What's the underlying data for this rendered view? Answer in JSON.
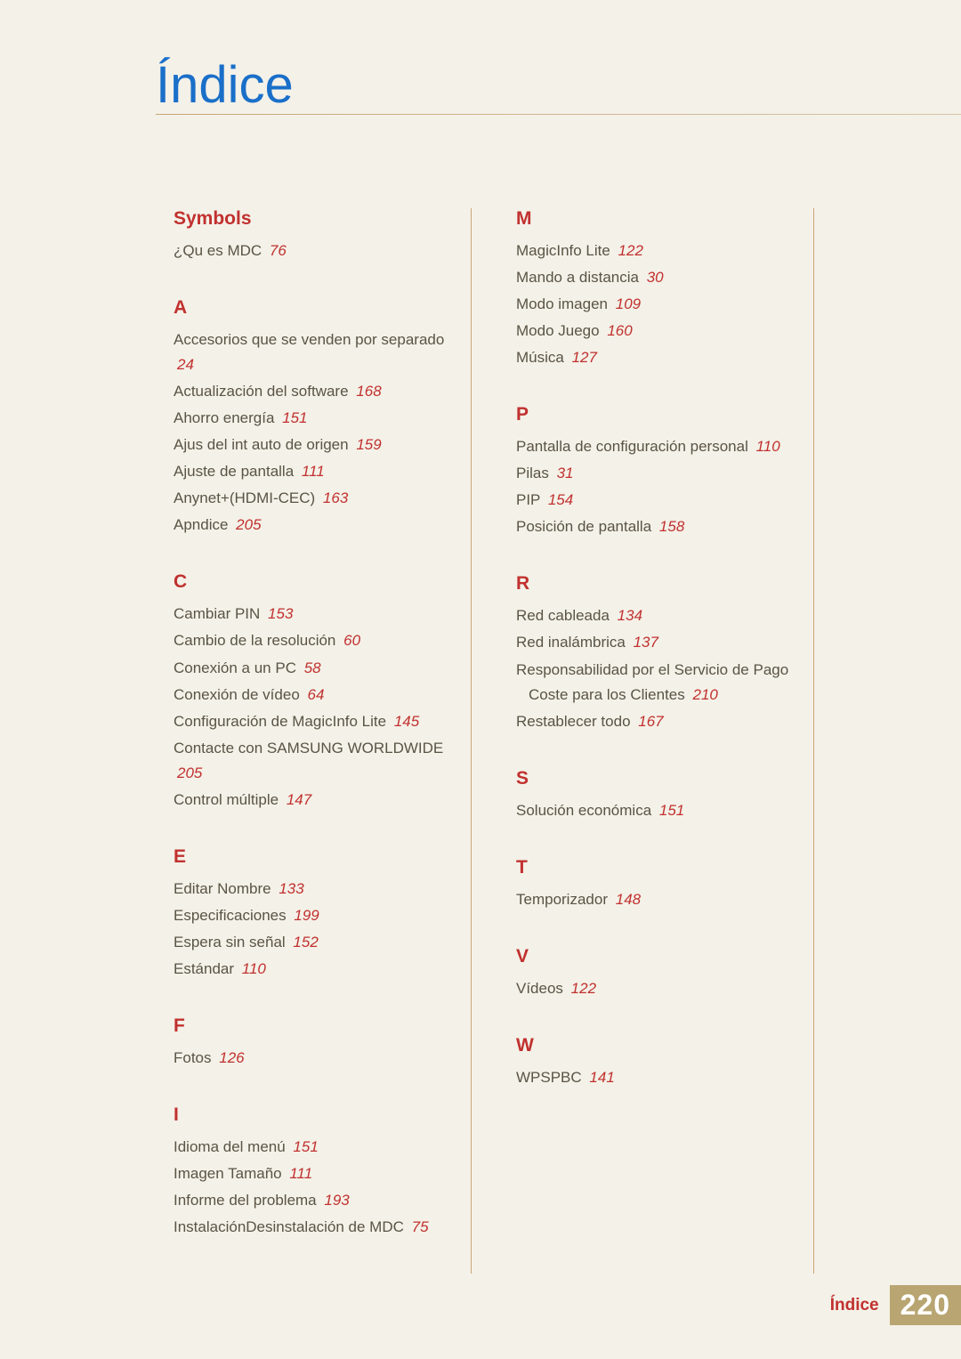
{
  "title": "Índice",
  "footer": {
    "label": "Índice",
    "page": "220"
  },
  "columns": [
    [
      {
        "letter": "Symbols",
        "entries": [
          {
            "text": "¿Qu es MDC",
            "page": "76"
          }
        ]
      },
      {
        "letter": "A",
        "entries": [
          {
            "text": "Accesorios que se venden por separado",
            "page": "24"
          },
          {
            "text": "Actualización del software",
            "page": "168"
          },
          {
            "text": "Ahorro energía",
            "page": "151"
          },
          {
            "text": "Ajus del int auto de origen",
            "page": "159"
          },
          {
            "text": "Ajuste de pantalla",
            "page": "111"
          },
          {
            "text": "Anynet+(HDMI-CEC)",
            "page": "163"
          },
          {
            "text": "Apndice",
            "page": "205"
          }
        ]
      },
      {
        "letter": "C",
        "entries": [
          {
            "text": "Cambiar PIN",
            "page": "153"
          },
          {
            "text": "Cambio de la resolución",
            "page": "60"
          },
          {
            "text": "Conexión a un PC",
            "page": "58"
          },
          {
            "text": "Conexión de vídeo",
            "page": "64"
          },
          {
            "text": "Configuración de MagicInfo Lite",
            "page": "145"
          },
          {
            "text": "Contacte con SAMSUNG WORLDWIDE",
            "page": "205"
          },
          {
            "text": "Control múltiple",
            "page": "147"
          }
        ]
      },
      {
        "letter": "E",
        "entries": [
          {
            "text": "Editar Nombre",
            "page": "133"
          },
          {
            "text": "Especificaciones",
            "page": "199"
          },
          {
            "text": "Espera sin señal",
            "page": "152"
          },
          {
            "text": "Estándar",
            "page": "110"
          }
        ]
      },
      {
        "letter": "F",
        "entries": [
          {
            "text": "Fotos",
            "page": "126"
          }
        ]
      },
      {
        "letter": "I",
        "entries": [
          {
            "text": "Idioma del menú",
            "page": "151"
          },
          {
            "text": "Imagen Tamaño",
            "page": "111"
          },
          {
            "text": "Informe del problema",
            "page": "193"
          },
          {
            "text": "InstalaciónDesinstalación de MDC",
            "page": "75"
          }
        ]
      }
    ],
    [
      {
        "letter": "M",
        "entries": [
          {
            "text": "MagicInfo Lite",
            "page": "122"
          },
          {
            "text": "Mando a distancia",
            "page": "30"
          },
          {
            "text": "Modo imagen",
            "page": "109"
          },
          {
            "text": "Modo Juego",
            "page": "160"
          },
          {
            "text": "Música",
            "page": "127"
          }
        ]
      },
      {
        "letter": "P",
        "entries": [
          {
            "text": "Pantalla de configuración personal",
            "page": "110"
          },
          {
            "text": "Pilas",
            "page": "31"
          },
          {
            "text": "PIP",
            "page": "154"
          },
          {
            "text": "Posición de pantalla",
            "page": "158"
          }
        ]
      },
      {
        "letter": "R",
        "entries": [
          {
            "text": "Red cableada",
            "page": "134"
          },
          {
            "text": "Red inalámbrica",
            "page": "137"
          },
          {
            "text": "Responsabilidad por el Servicio de Pago",
            "cont": "Coste para los Clientes",
            "page": "210"
          },
          {
            "text": "Restablecer todo",
            "page": "167"
          }
        ]
      },
      {
        "letter": "S",
        "entries": [
          {
            "text": "Solución económica",
            "page": "151"
          }
        ]
      },
      {
        "letter": "T",
        "entries": [
          {
            "text": "Temporizador",
            "page": "148"
          }
        ]
      },
      {
        "letter": "V",
        "entries": [
          {
            "text": "Vídeos",
            "page": "122"
          }
        ]
      },
      {
        "letter": "W",
        "entries": [
          {
            "text": "WPSPBC",
            "page": "141"
          }
        ]
      }
    ]
  ]
}
